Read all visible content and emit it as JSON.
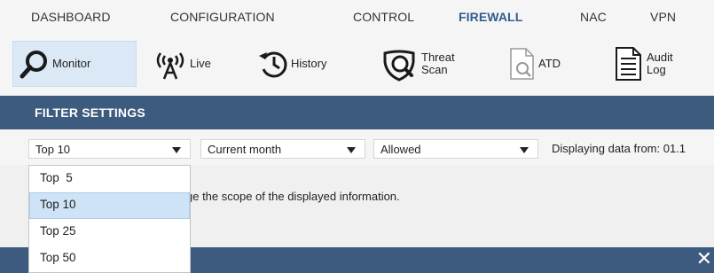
{
  "nav": {
    "items": [
      {
        "label": "DASHBOARD"
      },
      {
        "label": "CONFIGURATION"
      },
      {
        "label": "CONTROL"
      },
      {
        "label": "FIREWALL",
        "active": true
      },
      {
        "label": "NAC"
      },
      {
        "label": "VPN"
      }
    ]
  },
  "toolbar": {
    "monitor": "Monitor",
    "live": "Live",
    "history": "History",
    "threat_line1": "Threat",
    "threat_line2": "Scan",
    "atd": "ATD",
    "audit_line1": "Audit",
    "audit_line2": "Log"
  },
  "filter": {
    "title": "FILTER SETTINGS",
    "top_selected": "Top 10",
    "period": "Current month",
    "action": "Allowed",
    "displaying": "Displaying data from: 01.1"
  },
  "description": "ge the scope of the displayed information.",
  "dropdown": {
    "options": [
      "Top  5",
      "Top 10",
      "Top 25",
      "Top 50"
    ],
    "hovered_index": 1
  },
  "colors": {
    "accent_blue": "#2f5d8e",
    "header_bar": "#3d5a7f",
    "selected_bg": "#dbe8f5",
    "hover_bg": "#cfe3f6"
  },
  "icons": {
    "close": "✕"
  }
}
